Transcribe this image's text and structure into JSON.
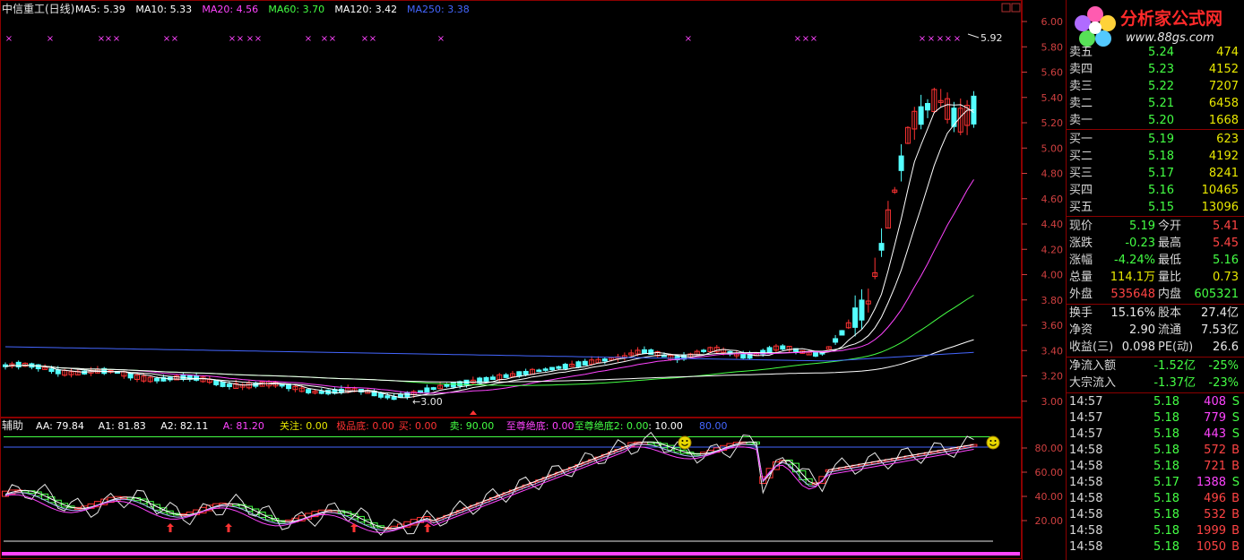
{
  "stock_name": "中信重工(日线)",
  "ma_legend": [
    {
      "label": "MA5: 5.39",
      "color": "#ffffff"
    },
    {
      "label": "MA10: 5.33",
      "color": "#ffffff"
    },
    {
      "label": "MA20: 4.56",
      "color": "#ff44ff"
    },
    {
      "label": "MA60: 3.70",
      "color": "#44ff44"
    },
    {
      "label": "MA120: 3.42",
      "color": "#ffffff"
    },
    {
      "label": "MA250: 3.38",
      "color": "#4466ff"
    }
  ],
  "price_axis": [
    "6.00",
    "5.80",
    "5.60",
    "5.40",
    "5.20",
    "5.00",
    "4.80",
    "4.60",
    "4.40",
    "4.20",
    "4.00",
    "3.80",
    "3.60",
    "3.40",
    "3.20",
    "3.00"
  ],
  "high_marker": "5.92",
  "low_marker": "3.00",
  "indicator_title": "辅助",
  "indicator_legend": [
    {
      "label": "AA: 79.84",
      "color": "#ffffff"
    },
    {
      "label": "A1: 81.83",
      "color": "#ffffff"
    },
    {
      "label": "A2: 82.11",
      "color": "#ffffff"
    },
    {
      "label": "A: 81.20",
      "color": "#ff44ff"
    },
    {
      "label": "关注: 0.00",
      "color": "#e8e800"
    },
    {
      "label": "极品底: 0.00",
      "color": "#ff3333"
    },
    {
      "label": "买: 0.00",
      "color": "#ff3333"
    },
    {
      "label": "卖: 90.00",
      "color": "#44ff44"
    },
    {
      "label": "至尊绝底: 0.00",
      "color": "#ff44ff"
    },
    {
      "label": "至尊绝底2: 0.00",
      "color": "#44ff44"
    },
    {
      "label": ": 10.00",
      "color": "#ffffff"
    },
    {
      "label": "80.00",
      "color": "#4466ff"
    }
  ],
  "indicator_axis": [
    "80.00",
    "60.00",
    "40.00",
    "20.00"
  ],
  "logo": {
    "title": "分析家公式网",
    "url": "www.88gs.com"
  },
  "order_book": {
    "asks": [
      {
        "label": "卖五",
        "price": "5.24",
        "volume": "474"
      },
      {
        "label": "卖四",
        "price": "5.23",
        "volume": "4152"
      },
      {
        "label": "卖三",
        "price": "5.22",
        "volume": "7207"
      },
      {
        "label": "卖二",
        "price": "5.21",
        "volume": "6458"
      },
      {
        "label": "卖一",
        "price": "5.20",
        "volume": "1668"
      }
    ],
    "bids": [
      {
        "label": "买一",
        "price": "5.19",
        "volume": "623"
      },
      {
        "label": "买二",
        "price": "5.18",
        "volume": "4192"
      },
      {
        "label": "买三",
        "price": "5.17",
        "volume": "8241"
      },
      {
        "label": "买四",
        "price": "5.16",
        "volume": "10465"
      },
      {
        "label": "买五",
        "price": "5.15",
        "volume": "13096"
      }
    ]
  },
  "quote": [
    {
      "l1": "现价",
      "v1": "5.19",
      "c1": "#44ff44",
      "l2": "今开",
      "v2": "5.41",
      "c2": "#ff4444"
    },
    {
      "l1": "涨跌",
      "v1": "-0.23",
      "c1": "#44ff44",
      "l2": "最高",
      "v2": "5.45",
      "c2": "#ff4444"
    },
    {
      "l1": "涨幅",
      "v1": "-4.24%",
      "c1": "#44ff44",
      "l2": "最低",
      "v2": "5.16",
      "c2": "#44ff44"
    },
    {
      "l1": "总量",
      "v1": "114.1万",
      "c1": "#e8e800",
      "l2": "量比",
      "v2": "0.73",
      "c2": "#e8e800"
    },
    {
      "l1": "外盘",
      "v1": "535648",
      "c1": "#ff4444",
      "l2": "内盘",
      "v2": "605321",
      "c2": "#44ff44"
    },
    {
      "l1": "换手",
      "v1": "15.16%",
      "c1": "#e8e8e8",
      "l2": "股本",
      "v2": "27.4亿",
      "c2": "#e8e8e8"
    },
    {
      "l1": "净资",
      "v1": "2.90",
      "c1": "#e8e8e8",
      "l2": "流通",
      "v2": "7.53亿",
      "c2": "#e8e8e8"
    },
    {
      "l1": "收益(三)",
      "v1": "0.098",
      "c1": "#e8e8e8",
      "l2": "PE(动)",
      "v2": "26.6",
      "c2": "#e8e8e8"
    }
  ],
  "flows": [
    {
      "label": "净流入额",
      "amount": "-1.52亿",
      "pct": "-25%"
    },
    {
      "label": "大宗流入",
      "amount": "-1.37亿",
      "pct": "-23%"
    }
  ],
  "ticks": [
    {
      "time": "14:57",
      "price": "5.18",
      "volume": "408",
      "side": "S"
    },
    {
      "time": "14:57",
      "price": "5.18",
      "volume": "779",
      "side": "S"
    },
    {
      "time": "14:57",
      "price": "5.18",
      "volume": "443",
      "side": "S"
    },
    {
      "time": "14:58",
      "price": "5.18",
      "volume": "572",
      "side": "B"
    },
    {
      "time": "14:58",
      "price": "5.18",
      "volume": "721",
      "side": "B"
    },
    {
      "time": "14:58",
      "price": "5.17",
      "volume": "1388",
      "side": "S"
    },
    {
      "time": "14:58",
      "price": "5.18",
      "volume": "496",
      "side": "B"
    },
    {
      "time": "14:58",
      "price": "5.18",
      "volume": "532",
      "side": "B"
    },
    {
      "time": "14:58",
      "price": "5.18",
      "volume": "1999",
      "side": "B"
    },
    {
      "time": "14:58",
      "price": "5.18",
      "volume": "1050",
      "side": "B"
    }
  ],
  "colors": {
    "up": "#ff3333",
    "down": "#54ffff",
    "grid": "#8b0000",
    "axis_text": "#d04040"
  }
}
